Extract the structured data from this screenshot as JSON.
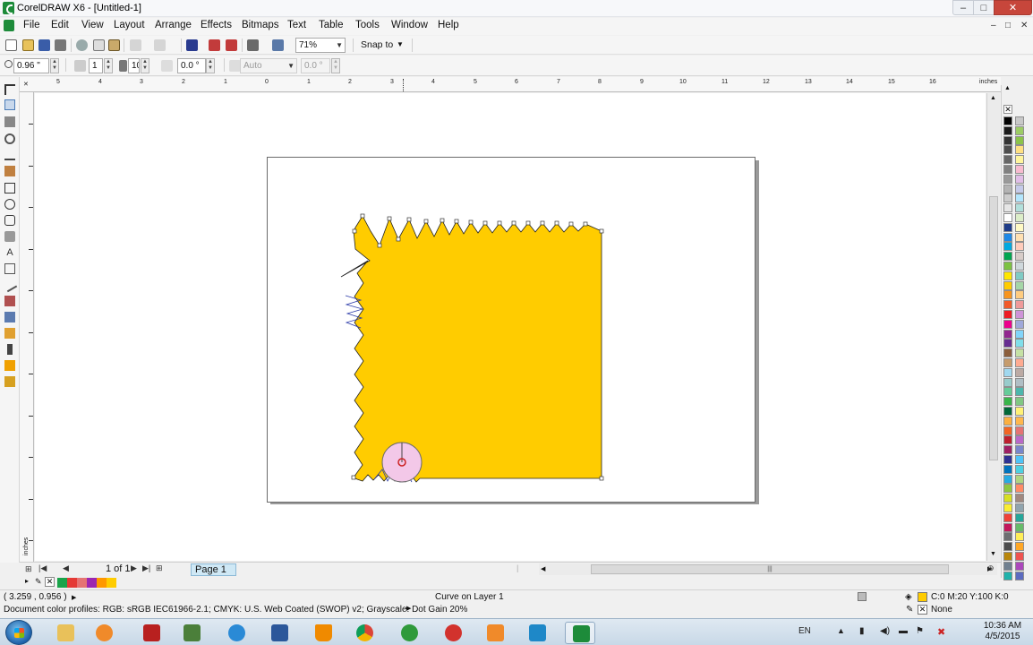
{
  "window": {
    "title": "CorelDRAW X6 - [Untitled-1]",
    "min_glyph": "–",
    "max_glyph": "□",
    "close_glyph": "✕"
  },
  "menu": {
    "items": [
      "File",
      "Edit",
      "View",
      "Layout",
      "Arrange",
      "Effects",
      "Bitmaps",
      "Text",
      "Table",
      "Tools",
      "Window",
      "Help"
    ],
    "doc_controls": [
      "–",
      "□",
      "✕"
    ]
  },
  "toolbar": {
    "zoom": "71%",
    "snap_to": "Snap to"
  },
  "property_bar": {
    "nib_size": "0.96 \"",
    "nib_count": "1",
    "width_value": "10",
    "angle": "0.0 °",
    "mode": "Auto",
    "mode_value": "0.0 °"
  },
  "rulers": {
    "unit": "inches",
    "h_labels": [
      "5",
      "4",
      "3",
      "2",
      "1",
      "0",
      "1",
      "2",
      "3",
      "4",
      "5",
      "6",
      "7",
      "8",
      "9",
      "10",
      "11",
      "12",
      "13",
      "14",
      "15",
      "16"
    ]
  },
  "page_nav": {
    "count": "1 of 1",
    "tab": "Page 1",
    "ruler_unit": "inches"
  },
  "status": {
    "coords": "( 3.259 , 0.956 )",
    "object_info": "Curve on Layer 1",
    "fill": "C:0 M:20 Y:100 K:0",
    "outline": "None",
    "color_profiles": "Document color profiles: RGB: sRGB IEC61966-2.1; CMYK: U.S. Web Coated (SWOP) v2; Grayscale: Dot Gain 20%"
  },
  "taskbar": {
    "language": "EN",
    "time": "10:36 AM",
    "date": "4/5/2015"
  },
  "colors": {
    "shape_fill": "#ffcc00",
    "brush_circle": "#f3c8e8",
    "accent_green": "#1d8b3a",
    "page_tab": "#cfe8f5"
  }
}
